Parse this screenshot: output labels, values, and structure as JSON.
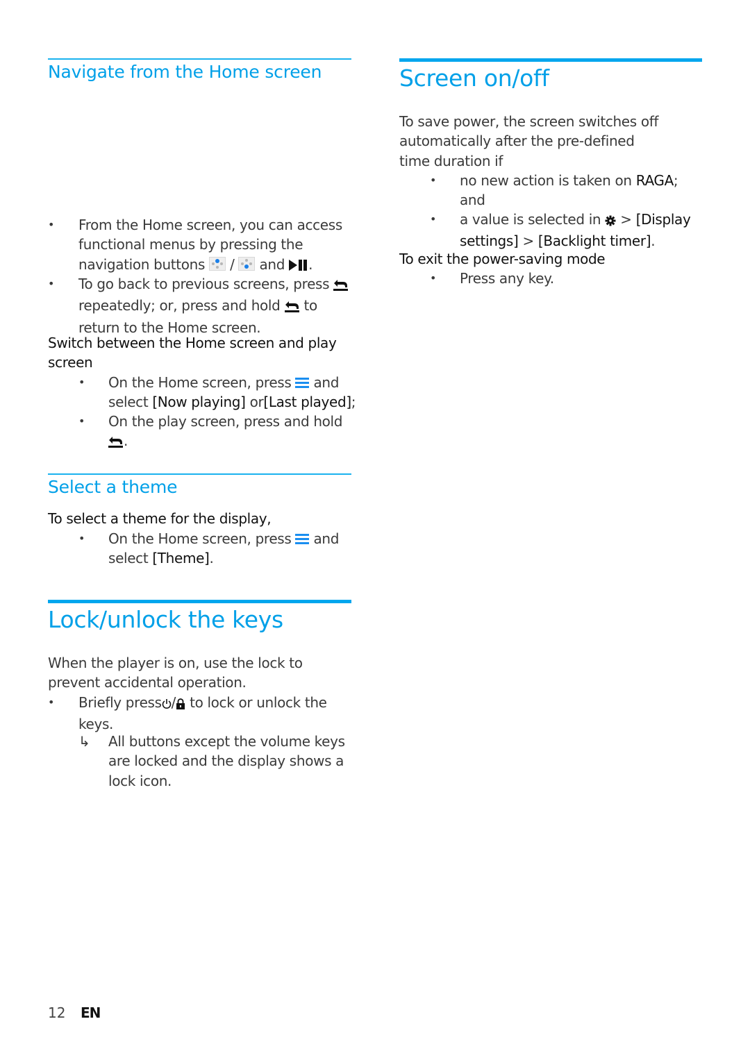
{
  "page": {
    "number": "12",
    "language": "EN",
    "accent_color": "#00a0e8"
  },
  "left": {
    "navigate": {
      "title": "Navigate from the Home screen",
      "bullets": [
        {
          "parts": [
            "From the Home screen, you can access functional menus by pressing the navigation buttons",
            "/",
            "and",
            "."
          ],
          "icons": [
            "nav-up-button-icon",
            "nav-down-button-icon",
            "play-pause-icon"
          ]
        },
        {
          "parts": [
            "To go back to previous screens, press",
            "repeatedly; or, press and hold",
            "to return to the Home screen."
          ],
          "icons": [
            "back-icon",
            "back-icon"
          ]
        }
      ],
      "switch_heading": "Switch between the Home screen and play screen",
      "switch_bullets": [
        {
          "parts": [
            "On the Home screen, press",
            "and select",
            "[Now playing]",
            "or",
            "[Last played]",
            ";"
          ],
          "icons": [
            "menu-icon"
          ]
        },
        {
          "parts": [
            "On the play screen, press and hold",
            "."
          ],
          "icons": [
            "back-icon"
          ]
        }
      ]
    },
    "theme": {
      "title": "Select a theme",
      "intro": "To select a theme for the display,",
      "bullets": [
        {
          "parts": [
            "On the Home screen, press",
            "and select",
            "[Theme]",
            "."
          ],
          "icons": [
            "menu-icon"
          ]
        }
      ]
    },
    "lock": {
      "title": "Lock/unlock the keys",
      "intro": "When the player is on, use the lock to prevent accidental operation.",
      "bullet": {
        "parts": [
          "Briefly press",
          "/",
          "to lock or unlock the keys."
        ],
        "icons": [
          "power-icon",
          "lock-icon"
        ]
      },
      "result_marker": "↳",
      "result": "All buttons except the volume keys are locked and the display shows a lock icon."
    }
  },
  "right": {
    "screen": {
      "title": "Screen on/off",
      "intro": "To save power, the screen switches off automatically after the pre-defined time duration if",
      "bullets": [
        {
          "parts": [
            "no new action is taken on",
            "RAGA",
            "; and"
          ]
        },
        {
          "parts": [
            "a value is selected in",
            ">",
            "[Display settings]",
            ">",
            "[Backlight timer]",
            "."
          ],
          "icons": [
            "settings-gear-icon"
          ]
        }
      ],
      "exit_heading": "To exit the power-saving mode",
      "exit_bullets": [
        {
          "parts": [
            "Press any key."
          ]
        }
      ]
    }
  }
}
